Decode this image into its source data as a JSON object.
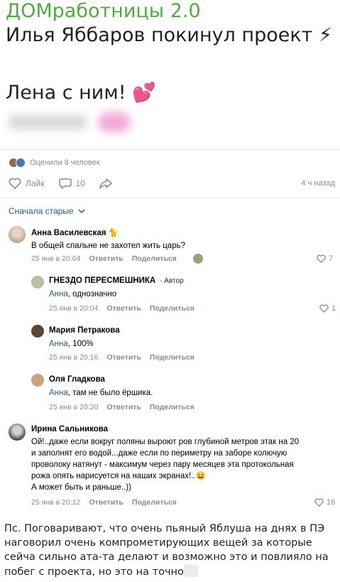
{
  "post": {
    "title_line1": "ДОМработницы 2.0",
    "title_line2": "Илья Яббаров покинул проект",
    "title_emoji2": "⚡",
    "title_line3": "Лена с ним!",
    "title_emoji3": "💕"
  },
  "stats": {
    "likers_text": "Оценили 8 человек",
    "like_label": "Лайк",
    "comments_count": "10",
    "time_ago": "4 ч назад"
  },
  "sort": {
    "label": "Сначала старые"
  },
  "comments": [
    {
      "name": "Анна Василевская",
      "name_emoji": "🐈",
      "text": "В общей спальне не захотел жить царь?",
      "date": "25 янв в 20:04",
      "reply": "Ответить",
      "share": "Поделиться",
      "likes": "7"
    },
    {
      "name": "ГНЕЗДО ПЕРЕСМЕШНИКА",
      "badge": "· Автор",
      "mention": "Анна",
      "text": ", однозначно",
      "date": "25 янв в 20:04",
      "reply": "Ответить",
      "share": "Поделиться",
      "likes": "1"
    },
    {
      "name": "Мария Петракова",
      "mention": "Анна",
      "text": ", 100%",
      "date": "25 янв в 20:16",
      "reply": "Ответить",
      "share": "Поделиться"
    },
    {
      "name": "Оля Гладкова",
      "mention": "Анна",
      "text": ", там не было ёршика.",
      "date": "25 янв в 20:20",
      "reply": "Ответить",
      "share": "Поделиться"
    },
    {
      "name": "Ирина Сальникова",
      "lines": [
        "Ой!..даже если вокруг поляны выроют ров глубиной метров этак на 20",
        "и заполнят его водой...даже если по периметру на заборе колючую",
        "проволоку натянут - максимум через пару месяцев эта протокольная",
        "рожа опять нарисуется на наших экранах!..😄",
        "А может быть и раньше..))"
      ],
      "date": "25 янв в 20:12",
      "reply": "Ответить",
      "share": "Поделиться",
      "likes": "16"
    }
  ],
  "ps": {
    "text": "Пс. Поговаривают, что очень пьяный Яблуша на днях в ПЭ наговорил очень компрометирующих вещей за которые сейча сильно ата-та делают и возможно это и повлияло на побег с проекта, но это на точно"
  },
  "colors": {
    "title_green": "#4cae3c",
    "link_blue": "#2a5885",
    "meta_grey": "#818c99"
  }
}
